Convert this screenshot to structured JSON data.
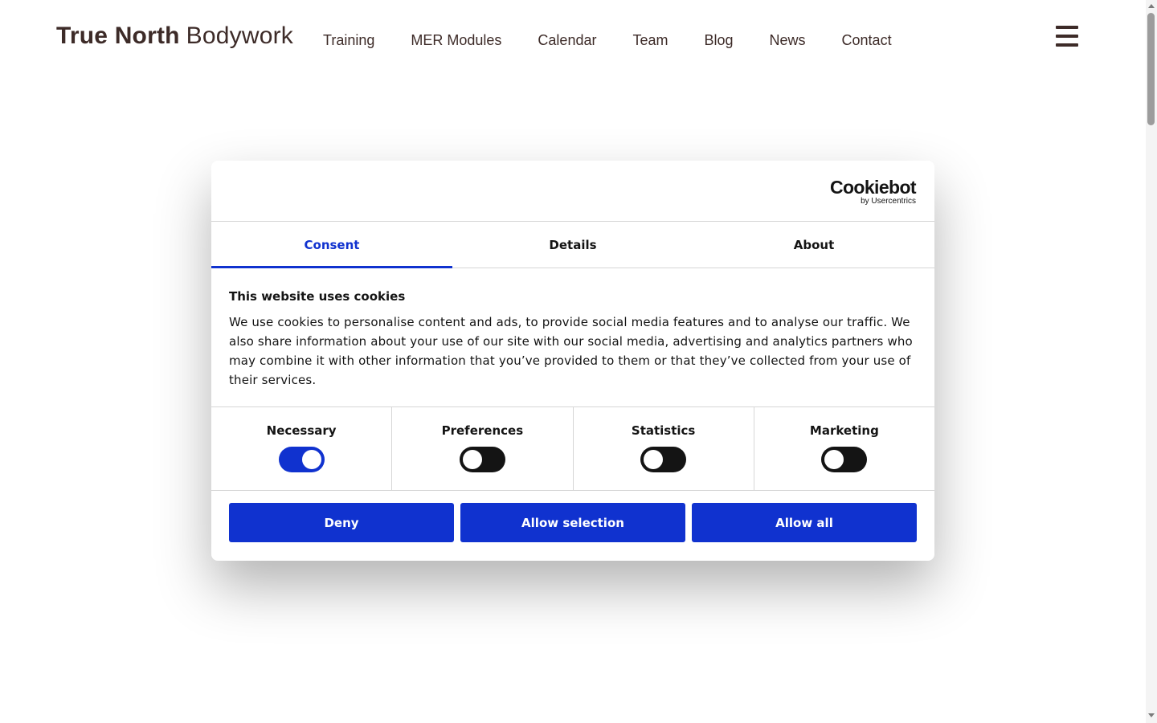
{
  "header": {
    "logo_bold": "True North",
    "logo_light": "Bodywork",
    "nav": [
      {
        "label": "Training"
      },
      {
        "label": "MER Modules"
      },
      {
        "label": "Calendar"
      },
      {
        "label": "Team"
      },
      {
        "label": "Blog"
      },
      {
        "label": "News"
      },
      {
        "label": "Contact"
      }
    ],
    "menu_icon": "hamburger-menu-icon"
  },
  "cookie_dialog": {
    "brand": "Cookiebot",
    "brand_sub": "by Usercentrics",
    "tabs": [
      {
        "label": "Consent",
        "active": true
      },
      {
        "label": "Details",
        "active": false
      },
      {
        "label": "About",
        "active": false
      }
    ],
    "heading": "This website uses cookies",
    "text": "We use cookies to personalise content and ads, to provide social media features and to analyse our traffic. We also share information about your use of our site with our social media, advertising and analytics partners who may combine it with other information that you’ve provided to them or that they’ve collected from your use of their services.",
    "toggles": [
      {
        "label": "Necessary",
        "on": true
      },
      {
        "label": "Preferences",
        "on": false
      },
      {
        "label": "Statistics",
        "on": false
      },
      {
        "label": "Marketing",
        "on": false
      }
    ],
    "buttons": {
      "deny": "Deny",
      "allow_selection": "Allow selection",
      "allow_all": "Allow all"
    }
  },
  "colors": {
    "accent": "#1032cf",
    "text": "#141414",
    "brand_text": "#3d2b28"
  }
}
